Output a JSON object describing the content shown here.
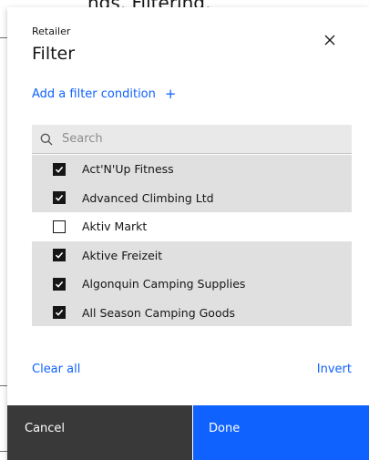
{
  "background": {
    "title_fragment": "ngs, Filtering,"
  },
  "dialog": {
    "subtitle": "Retailer",
    "title": "Filter",
    "close_icon": "close-icon",
    "add_condition_label": "Add a filter condition",
    "add_condition_icon": "plus-icon",
    "search": {
      "placeholder": "Search",
      "value": ""
    },
    "items": [
      {
        "label": "Act'N'Up Fitness",
        "checked": true
      },
      {
        "label": "Advanced Climbing Ltd",
        "checked": true
      },
      {
        "label": "Aktiv Markt",
        "checked": false
      },
      {
        "label": "Aktive Freizeit",
        "checked": true
      },
      {
        "label": "Algonquin Camping Supplies",
        "checked": true
      },
      {
        "label": "All Season Camping Goods",
        "checked": true
      }
    ],
    "clear_all_label": "Clear all",
    "invert_label": "Invert",
    "cancel_label": "Cancel",
    "done_label": "Done"
  },
  "colors": {
    "accent": "#0f62fe",
    "cancel_bg": "#393939",
    "checked_row_bg": "#e0e0e0"
  }
}
